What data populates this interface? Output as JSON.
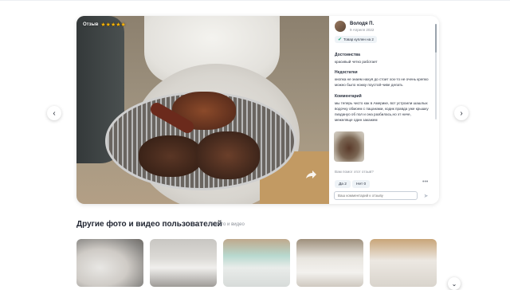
{
  "review_card": {
    "badge": {
      "label": "Отзыв",
      "rating": 5,
      "stars": "★★★★★"
    },
    "author": {
      "name": "Володя П.",
      "date": "9 Апреля 2022"
    },
    "purchase_badge": "Товар куплен на 2",
    "advantages": {
      "heading": "Достоинства",
      "text": "красивый четко работает"
    },
    "disadvantages": {
      "heading": "Недостатки",
      "text": "кнопка не знаем нахуя до стоит хох-то не очень крепко можно было ножку поустой-чиве делать"
    },
    "comment": {
      "heading": "Комментарий",
      "text": "мы теперь чисто как в Америке, вот устроили шашлык водочку обмоем с пацанами, кодик правда уже крышку пиздануо об пол и она разбилась,но эт ниче, межеляще один закажем"
    },
    "helpful_question": "Вам помог этот отзыв?",
    "yes_label": "Да 2",
    "no_label": "Нет 0",
    "more_label": "•••",
    "comment_placeholder": "Ваш комментарий к отзыву",
    "icons": {
      "share": "share-arrow-icon",
      "send": "send-icon",
      "check": "check-icon"
    }
  },
  "navigation": {
    "prev": "‹",
    "next": "›",
    "down": "⌄"
  },
  "gallery": {
    "title": "Другие фото и видео пользователей",
    "count": "115 фото и видео"
  },
  "colors": {
    "star": "#ffb400",
    "accent": "#19a974",
    "text": "#1f2430"
  }
}
